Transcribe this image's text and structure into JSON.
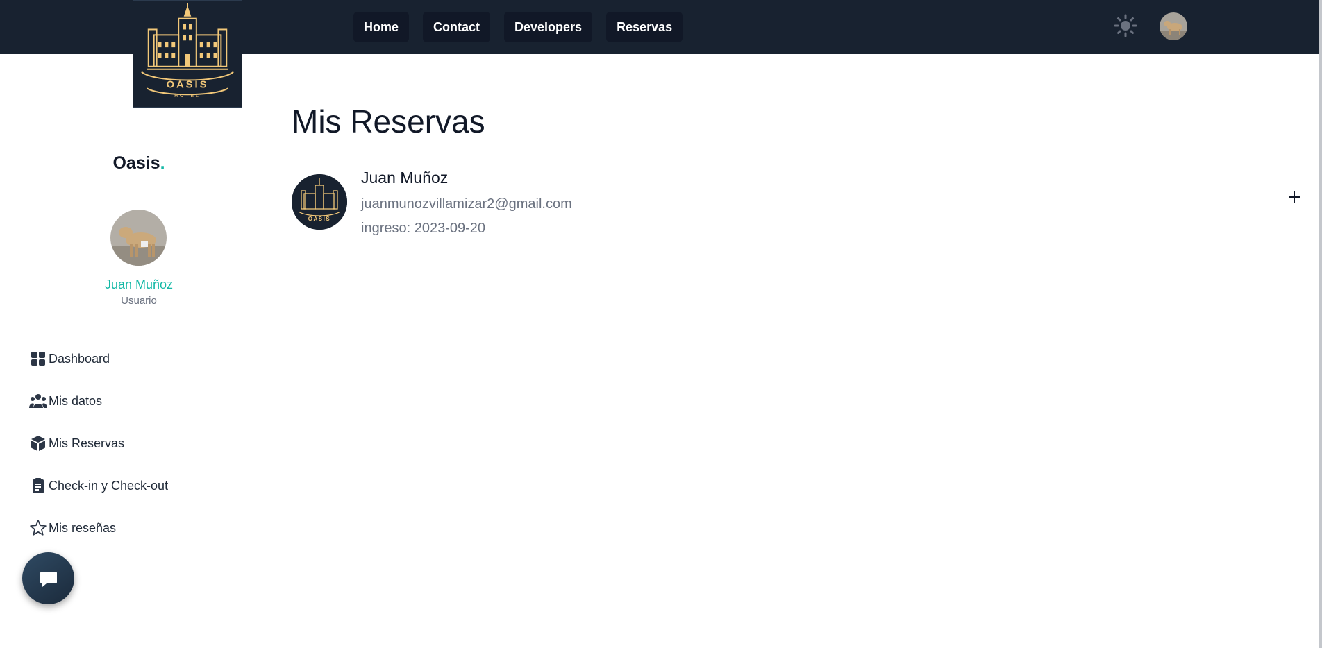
{
  "navbar": {
    "links": [
      {
        "label": "Home"
      },
      {
        "label": "Contact"
      },
      {
        "label": "Developers"
      },
      {
        "label": "Reservas"
      }
    ],
    "logo_text": "OASIS",
    "logo_subtext": "HOTEL",
    "theme_icon": "sun-icon",
    "avatar_icon": "user-avatar"
  },
  "sidebar": {
    "brand": "Oasis",
    "brand_dot": ".",
    "user_name": "Juan Muñoz",
    "user_role": "Usuario",
    "items": [
      {
        "label": "Dashboard",
        "icon": "grid-icon"
      },
      {
        "label": "Mis datos",
        "icon": "users-icon"
      },
      {
        "label": "Mis Reservas",
        "icon": "box-icon"
      },
      {
        "label": "Check-in y Check-out",
        "icon": "clipboard-icon"
      },
      {
        "label": "Mis reseñas",
        "icon": "star-icon"
      }
    ]
  },
  "main": {
    "title": "Mis Reservas",
    "reservation": {
      "name": "Juan Muñoz",
      "email": "juanmunozvillamizar2@gmail.com",
      "date": "ingreso: 2023-09-20"
    }
  },
  "colors": {
    "navbar_bg": "#182230",
    "accent": "#14b8a6",
    "gold": "#f2c879"
  }
}
